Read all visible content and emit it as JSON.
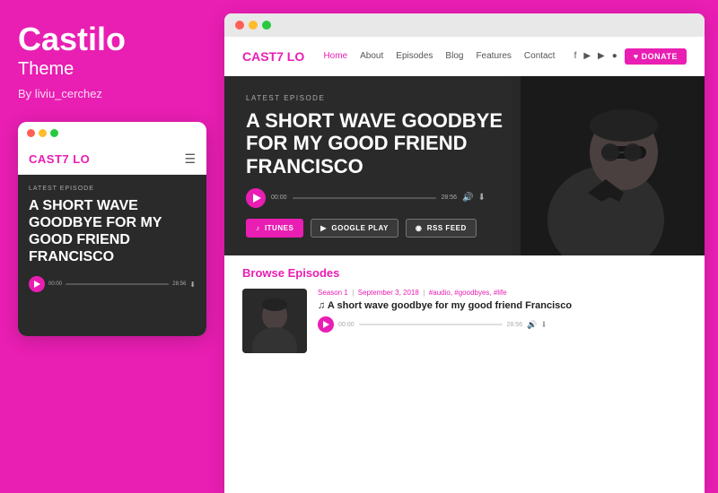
{
  "left": {
    "title": "Castilo",
    "subtitle": "Theme",
    "author": "By liviu_cerchez",
    "mobile_card": {
      "dots": [
        "red",
        "yellow",
        "green"
      ],
      "logo": "CAST",
      "logo_symbol": "7",
      "logo_suffix": " LO",
      "latest_label": "LATEST EPISODE",
      "episode_title": "A SHORT WAVE GOODBYE FOR MY GOOD FRIEND FRANCISCO",
      "time_start": "00:00",
      "time_end": "28:56"
    }
  },
  "browser": {
    "dots": [
      "red",
      "yellow",
      "green"
    ],
    "nav": {
      "logo": "CAST",
      "logo_symbol": "7",
      "logo_suffix": " LO",
      "links": [
        "Home",
        "About",
        "Episodes",
        "Blog",
        "Features",
        "Contact"
      ],
      "active_link": "Home",
      "donate_label": "♥ DONATE"
    },
    "hero": {
      "latest_label": "LATEST EPISODE",
      "title": "A SHORT WAVE GOODBYE FOR MY GOOD FRIEND FRANCISCO",
      "time_start": "00:00",
      "time_end": "28:56",
      "buttons": [
        {
          "id": "itunes",
          "icon": "♪",
          "label": "ITUNES"
        },
        {
          "id": "google",
          "icon": "▶",
          "label": "GOOGLE PLAY"
        },
        {
          "id": "rss",
          "icon": "◉",
          "label": "RSS FEED"
        }
      ]
    },
    "browse": {
      "title": "Browse",
      "title_accent": "Episodes",
      "episode": {
        "season": "Season 1",
        "date": "September 3, 2018",
        "tags": "#audio, #goodbyes, #life",
        "title": "♫  A short wave goodbye for my good friend Francisco",
        "time_start": "00:00",
        "time_end": "28:56"
      }
    }
  },
  "colors": {
    "accent": "#e91eb3",
    "dark_bg": "#2a2a2a",
    "light_bg": "#ffffff"
  }
}
